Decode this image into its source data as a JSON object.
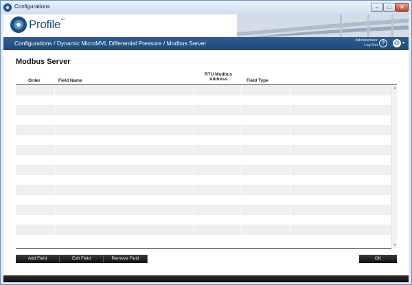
{
  "window": {
    "title": "Configurations",
    "controls": {
      "minimize": "–",
      "maximize": "□",
      "close": "✕"
    }
  },
  "header": {
    "logo_text": "Profile",
    "logo_tm": "TM",
    "breadcrumb": "Configurations / Dynamic MicroMVL Differential Pressure / Modbus Server",
    "user_name": "Administrator",
    "logout_label": "Log Out",
    "help_glyph": "?",
    "globe_glyph": "@",
    "caret_glyph": "▾"
  },
  "main": {
    "title": "Modbus Server",
    "columns": [
      {
        "label": "Order"
      },
      {
        "label": "Field Name"
      },
      {
        "label": "RTU Modbus Address"
      },
      {
        "label": "Field Type"
      }
    ],
    "rows": 16,
    "scroll_up": "▲",
    "scroll_down": "▼"
  },
  "buttons": {
    "add_field": "Add Field",
    "edit_field": "Edit Field",
    "remove_field": "Remove Field",
    "ok": "OK"
  },
  "colors": {
    "nav_bar": "#1d4878",
    "button_dark": "#111111",
    "row_alt": "#efefef"
  },
  "icons": [
    "app-icon",
    "help-icon",
    "globe-icon",
    "chevron-down-icon",
    "scroll-up-icon",
    "scroll-down-icon"
  ]
}
